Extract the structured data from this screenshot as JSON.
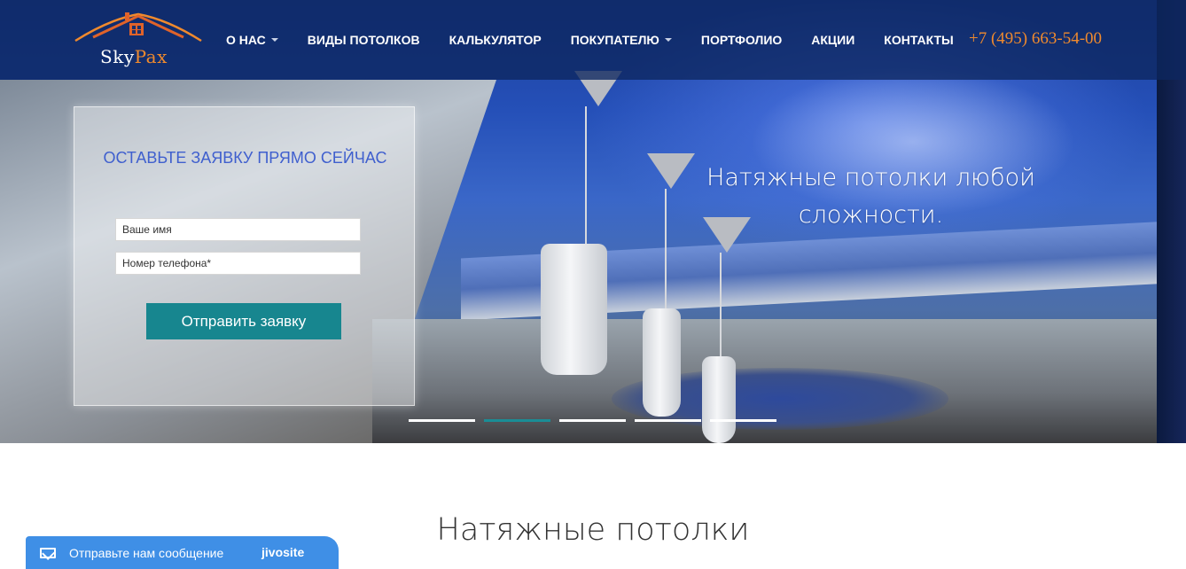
{
  "header": {
    "logo_prefix": "Sky",
    "logo_suffix": "Pax",
    "nav": [
      {
        "label": "О НАС",
        "dropdown": true
      },
      {
        "label": "ВИДЫ ПОТОЛКОВ",
        "dropdown": false
      },
      {
        "label": "КАЛЬКУЛЯТОР",
        "dropdown": false
      },
      {
        "label": "ПОКУПАТЕЛЮ",
        "dropdown": true
      },
      {
        "label": "ПОРТФОЛИО",
        "dropdown": false
      },
      {
        "label": "АКЦИИ",
        "dropdown": false
      },
      {
        "label": "КОНТАКТЫ",
        "dropdown": false
      }
    ],
    "phone": "+7 (495) 663-54-00"
  },
  "hero": {
    "form": {
      "title": "ОСТАВЬТЕ ЗАЯВКУ ПРЯМО СЕЙЧАС",
      "name_placeholder": "Ваше имя",
      "phone_placeholder": "Номер телефона*",
      "submit_label": "Отправить заявку"
    },
    "caption": "Натяжные потолки любой сложности.",
    "slider": {
      "count": 5,
      "active": 2
    }
  },
  "section": {
    "title": "Натяжные потолки"
  },
  "chat": {
    "label": "Отправьте нам сообщение",
    "brand": "jivosite"
  },
  "colors": {
    "accent_orange": "#f08a2d",
    "button_teal": "#17868f",
    "form_title_blue": "#3f5fce",
    "chat_blue": "#3f8fe6"
  }
}
